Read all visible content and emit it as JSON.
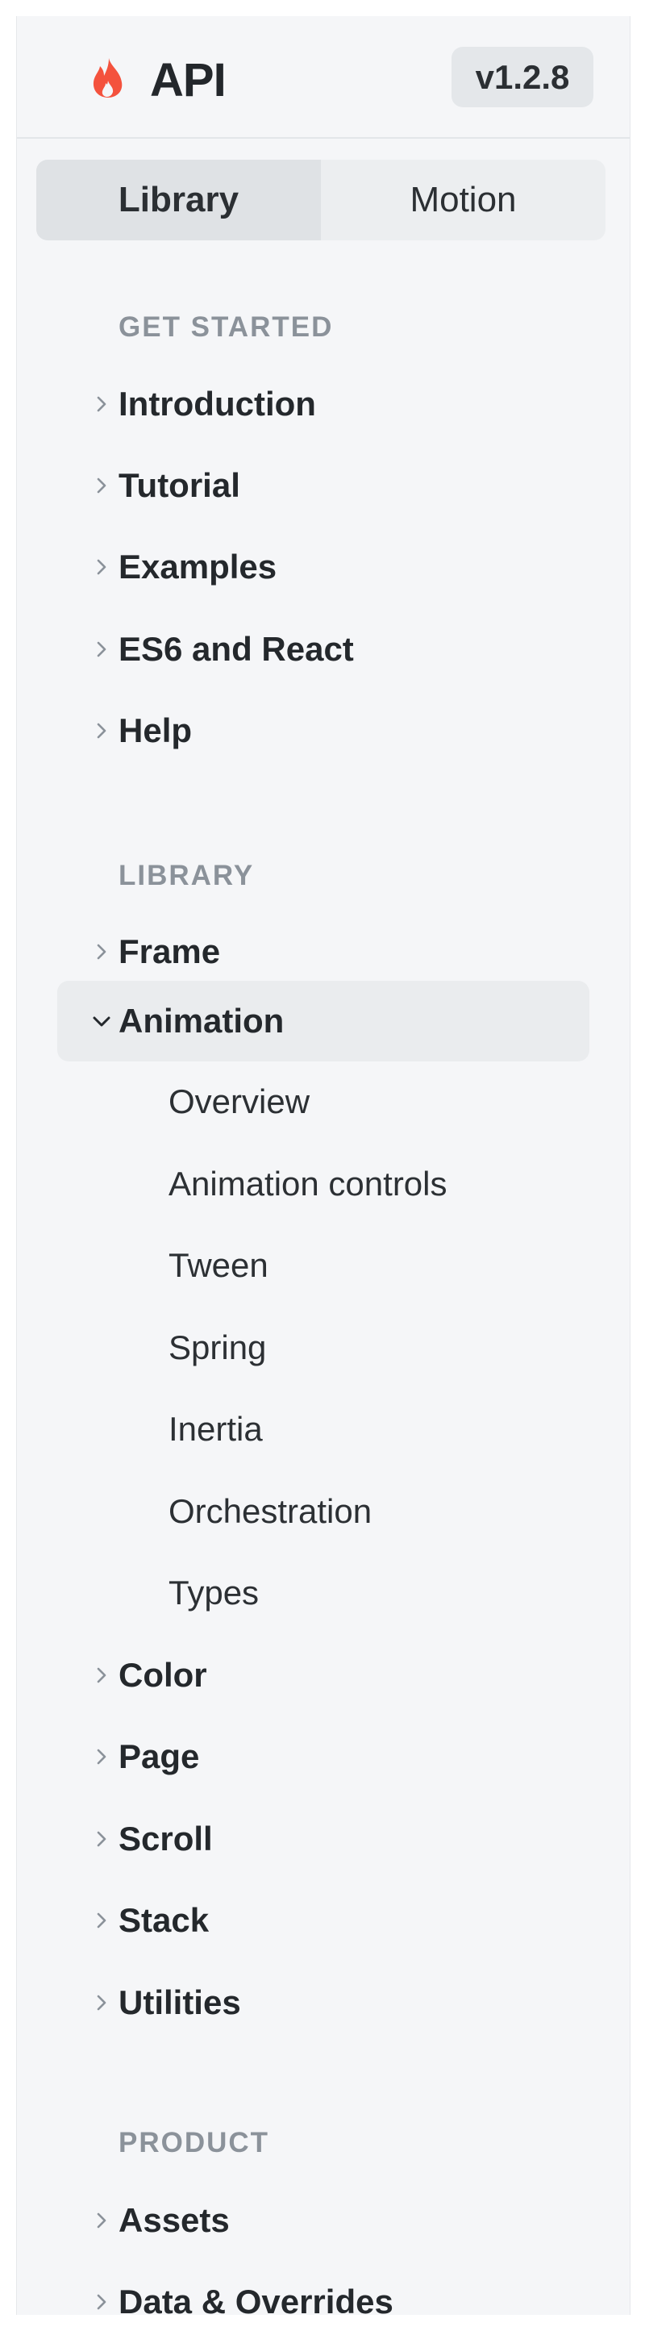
{
  "header": {
    "title": "API",
    "version": "v1.2.8",
    "logo_icon": "flame-icon",
    "logo_color": "#f4523d"
  },
  "segmented": {
    "options": [
      "Library",
      "Motion"
    ],
    "selected": "Library"
  },
  "sections": [
    {
      "title": "GET STARTED",
      "items": [
        {
          "label": "Introduction"
        },
        {
          "label": "Tutorial"
        },
        {
          "label": "Examples"
        },
        {
          "label": "ES6 and React"
        },
        {
          "label": "Help"
        }
      ]
    },
    {
      "title": "LIBRARY",
      "items": [
        {
          "label": "Frame"
        },
        {
          "label": "Animation",
          "expanded": true,
          "children": [
            "Overview",
            "Animation controls",
            "Tween",
            "Spring",
            "Inertia",
            "Orchestration",
            "Types"
          ]
        },
        {
          "label": "Color"
        },
        {
          "label": "Page"
        },
        {
          "label": "Scroll"
        },
        {
          "label": "Stack"
        },
        {
          "label": "Utilities"
        }
      ]
    },
    {
      "title": "PRODUCT",
      "items": [
        {
          "label": "Assets"
        },
        {
          "label": "Data & Overrides"
        }
      ]
    }
  ]
}
